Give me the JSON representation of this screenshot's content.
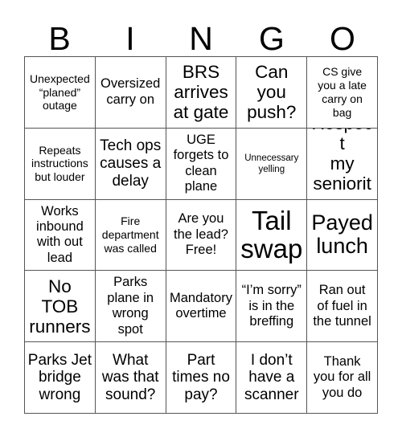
{
  "header": {
    "letters": [
      "B",
      "I",
      "N",
      "G",
      "O"
    ]
  },
  "grid": {
    "columns": 5,
    "rows": 5,
    "cells": [
      {
        "text": "Unexpected\n“planed”\noutage",
        "size": "fs-sm"
      },
      {
        "text": "Oversized\ncarry on",
        "size": "fs-md"
      },
      {
        "text": "BRS\narrives\nat gate",
        "size": "fs-xl"
      },
      {
        "text": "Can\nyou\npush?",
        "size": "fs-xl"
      },
      {
        "text": "CS give\nyou a late\ncarry on\nbag",
        "size": "fs-sm"
      },
      {
        "text": "Repeats\ninstructions\nbut louder",
        "size": "fs-sm"
      },
      {
        "text": "Tech ops\ncauses a\ndelay",
        "size": "fs-lg"
      },
      {
        "text": "UGE\nforgets to\nclean\nplane",
        "size": "fs-md"
      },
      {
        "text": "Unnecessary\nyelling",
        "size": "fs-xs"
      },
      {
        "text": "Respect\nmy\nseniority",
        "size": "fs-xl"
      },
      {
        "text": "Works\ninbound\nwith out\nlead",
        "size": "fs-md"
      },
      {
        "text": "Fire\ndepartment\nwas called",
        "size": "fs-sm"
      },
      {
        "text": "Are you\nthe lead?\nFree!",
        "size": "fs-md"
      },
      {
        "text": "Tail\nswap",
        "size": "fs-huge"
      },
      {
        "text": "Payed\nlunch",
        "size": "fs-xxl"
      },
      {
        "text": "No\nTOB\nrunners",
        "size": "fs-xl"
      },
      {
        "text": "Parks\nplane in\nwrong\nspot",
        "size": "fs-md"
      },
      {
        "text": "Mandatory\novertime",
        "size": "fs-md"
      },
      {
        "text": "“I’m sorry”\nis in the\nbreffing",
        "size": "fs-md"
      },
      {
        "text": "Ran out\nof fuel in\nthe tunnel",
        "size": "fs-md"
      },
      {
        "text": "Parks Jet\nbridge\nwrong",
        "size": "fs-lg"
      },
      {
        "text": "What\nwas that\nsound?",
        "size": "fs-lg"
      },
      {
        "text": "Part\ntimes no\npay?",
        "size": "fs-lg"
      },
      {
        "text": "I don’t\nhave a\nscanner",
        "size": "fs-lg"
      },
      {
        "text": "Thank\nyou for all\nyou do",
        "size": "fs-md"
      }
    ]
  },
  "colors": {
    "background": "#ffffff",
    "text": "#000000",
    "grid_line": "#555555"
  }
}
